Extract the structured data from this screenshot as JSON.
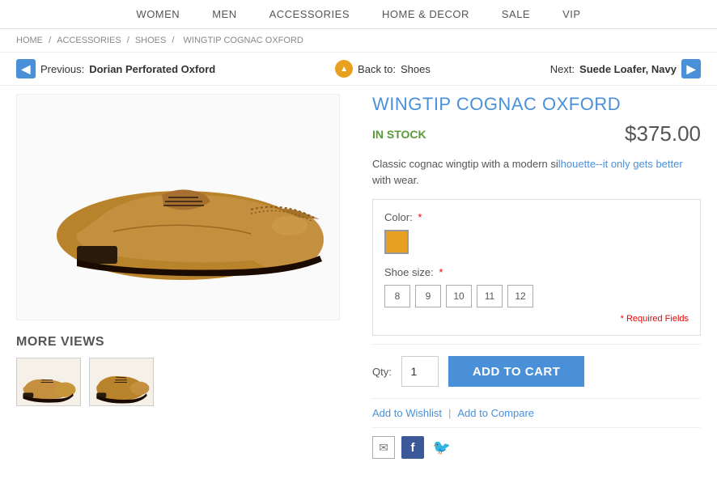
{
  "nav": {
    "items": [
      {
        "label": "WOMEN",
        "id": "women"
      },
      {
        "label": "MEN",
        "id": "men"
      },
      {
        "label": "ACCESSORIES",
        "id": "accessories"
      },
      {
        "label": "HOME & DECOR",
        "id": "home-decor"
      },
      {
        "label": "SALE",
        "id": "sale"
      },
      {
        "label": "VIP",
        "id": "vip"
      }
    ]
  },
  "breadcrumb": {
    "parts": [
      {
        "label": "HOME"
      },
      {
        "label": "ACCESSORIES"
      },
      {
        "label": "SHOES"
      },
      {
        "label": "WINGTIP COGNAC OXFORD"
      }
    ]
  },
  "prev_nav": {
    "label": "Previous: ",
    "bold": "Dorian Perforated Oxford"
  },
  "back_nav": {
    "prefix": "Back to: ",
    "label": "Shoes"
  },
  "next_nav": {
    "prefix": "Next: ",
    "label": "Suede Loafer, Navy"
  },
  "product": {
    "title": "WINGTIP COGNAC OXFORD",
    "stock": "IN STOCK",
    "price": "$375.00",
    "description": "Classic cognac wingtip with a modern silhouette--it only gets better with wear.",
    "color_label": "Color:",
    "shoe_size_label": "Shoe size:",
    "required_mark": "*",
    "required_fields_text": "* Required Fields",
    "sizes": [
      "8",
      "9",
      "10",
      "11",
      "12"
    ],
    "color": "#e8a020"
  },
  "cart": {
    "qty_label": "Qty:",
    "qty_value": "1",
    "add_btn": "ADD TO CART"
  },
  "actions": {
    "wishlist": "Add to Wishlist",
    "compare": "Add to Compare"
  },
  "more_views": {
    "label": "MORE VIEWS"
  },
  "icons": {
    "prev_arrow": "◀",
    "next_arrow": "▶",
    "back_arrow": "▲",
    "email": "✉",
    "facebook": "f",
    "twitter": "🐦"
  }
}
